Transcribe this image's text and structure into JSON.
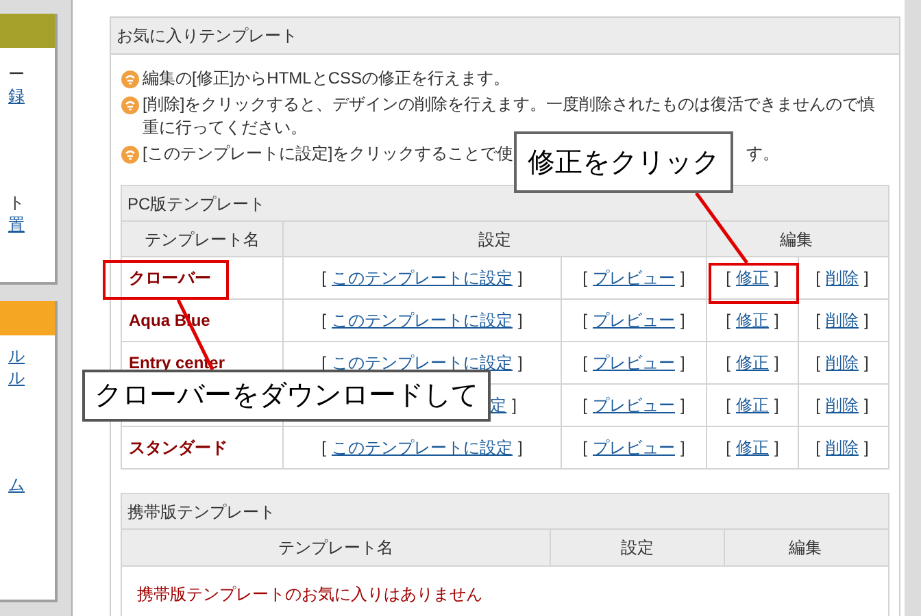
{
  "sidebar": {
    "panels": [
      {
        "color": "#a5a12a",
        "items": [
          {
            "text": "ー",
            "link": false
          },
          {
            "text": "録",
            "link": true
          },
          {
            "text": "ト",
            "link": false
          },
          {
            "text": "置",
            "link": true
          }
        ]
      },
      {
        "color": "#f5a623",
        "items": [
          {
            "text": "ル",
            "link": true
          },
          {
            "text": "ル",
            "link": true
          },
          {
            "text": "ム",
            "link": true
          }
        ]
      }
    ]
  },
  "panel": {
    "title": "お気に入りテンプレート",
    "notes": [
      {
        "text": "編集の[修正]からHTMLとCSSの修正を行えます。"
      },
      {
        "text": "[削除]をクリックすると、デザインの削除を行えます。一度削除されたものは復活できませんので慎重に行ってください。"
      },
      {
        "text": "[このテンプレートに設定]をクリックすることで使",
        "tail": "す。"
      }
    ]
  },
  "pc_table": {
    "title": "PC版テンプレート",
    "columns": [
      "テンプレート名",
      "設定",
      "編集"
    ],
    "rows": [
      {
        "name": "クローバー",
        "set": {
          "open": "[",
          "link": "このテンプレートに設定",
          "close": "]"
        },
        "preview": {
          "open": "[",
          "link": "プレビュー",
          "close": "]"
        },
        "edit": {
          "open": "[",
          "link": "修正",
          "close": "]"
        },
        "delete": {
          "open": "[",
          "link": "削除",
          "close": "]"
        }
      },
      {
        "name": "Aqua Blue",
        "set": {
          "open": "[",
          "link": "このテンプレートに設定",
          "close": "]"
        },
        "preview": {
          "open": "[",
          "link": "プレビュー",
          "close": "]"
        },
        "edit": {
          "open": "[",
          "link": "修正",
          "close": "]"
        },
        "delete": {
          "open": "[",
          "link": "削除",
          "close": "]"
        }
      },
      {
        "name": "Entry center",
        "set": {
          "open": "[",
          "link": "このテンプレートに設定",
          "close": "]"
        },
        "preview": {
          "open": "[",
          "link": "プレビュー",
          "close": "]"
        },
        "edit": {
          "open": "[",
          "link": "修正",
          "close": "]"
        },
        "delete": {
          "open": "[",
          "link": "削除",
          "close": "]"
        }
      },
      {
        "set": {
          "link": "定",
          "close": "]"
        },
        "preview": {
          "open": "[",
          "link": "プレビュー",
          "close": "]"
        },
        "edit": {
          "open": "[",
          "link": "修正",
          "close": "]"
        },
        "delete": {
          "open": "[",
          "link": "削除",
          "close": "]"
        }
      },
      {
        "name": "スタンダード",
        "set": {
          "open": "[",
          "link": "このテンプレートに設定",
          "close": "]"
        },
        "preview": {
          "open": "[",
          "link": "プレビュー",
          "close": "]"
        },
        "edit": {
          "open": "[",
          "link": "修正",
          "close": "]"
        },
        "delete": {
          "open": "[",
          "link": "削除",
          "close": "]"
        }
      }
    ]
  },
  "mobile_table": {
    "title": "携帯版テンプレート",
    "columns": [
      "テンプレート名",
      "設定",
      "編集"
    ],
    "empty_message": "携帯版テンプレートのお気に入りはありません"
  },
  "callouts": [
    {
      "text": "修正をクリック"
    },
    {
      "text": "クローバーをダウンロードして"
    }
  ]
}
